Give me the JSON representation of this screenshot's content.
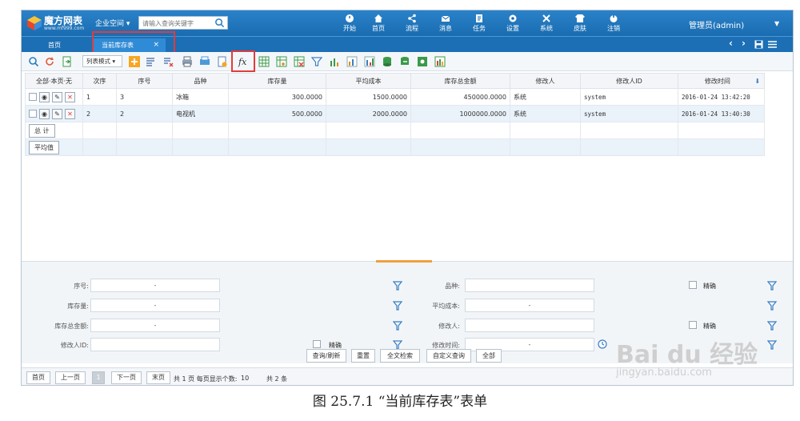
{
  "app": {
    "title": "魔方网表",
    "url": "www.mf999.com",
    "space_menu": "企业空间 ▾",
    "search_placeholder": "请输入查询关键字",
    "user": "管理员(admin)"
  },
  "nav": [
    {
      "label": "开始",
      "icon": "power-icon"
    },
    {
      "label": "首页",
      "icon": "home-icon"
    },
    {
      "label": "流程",
      "icon": "share-icon"
    },
    {
      "label": "消息",
      "icon": "mail-icon"
    },
    {
      "label": "任务",
      "icon": "clipboard-icon"
    },
    {
      "label": "设置",
      "icon": "gear-icon"
    },
    {
      "label": "系统",
      "icon": "tools-icon"
    },
    {
      "label": "皮肤",
      "icon": "shirt-icon"
    },
    {
      "label": "注销",
      "icon": "logout-icon"
    }
  ],
  "tabs": {
    "home": "首页",
    "active": "当前库存表",
    "close": "×"
  },
  "toolbar": {
    "mode": "列表模式 ▾"
  },
  "grid": {
    "selector_header": "全部·本页·无",
    "columns": [
      "次序",
      "序号",
      "品种",
      "库存量",
      "平均成本",
      "库存总金额",
      "修改人",
      "修改人ID",
      "修改时间"
    ],
    "rows": [
      [
        "1",
        "3",
        "冰箱",
        "300.0000",
        "1500.0000",
        "450000.0000",
        "系统",
        "system",
        "2016-01-24 13:42:20"
      ],
      [
        "2",
        "2",
        "电视机",
        "500.0000",
        "2000.0000",
        "1000000.0000",
        "系统",
        "system",
        "2016-01-24 13:40:30"
      ]
    ],
    "total_label": "总 计",
    "avg_label": "平均值"
  },
  "filter": {
    "labels": {
      "seq": "序号:",
      "kind": "品种:",
      "qty": "库存量:",
      "avg": "平均成本:",
      "total": "库存总金额:",
      "editor": "修改人:",
      "editor_id": "修改人ID:",
      "mtime": "修改时间:"
    },
    "range_dash": "-",
    "exact": "精确",
    "buttons": [
      "查询/刷新",
      "重置",
      "全文检索",
      "自定义查询",
      "全部"
    ]
  },
  "pager": {
    "first": "首页",
    "prev": "上一页",
    "current": "1",
    "next": "下一页",
    "last": "末页",
    "info": "共 1 页 每页显示个数:",
    "page_size": "10",
    "count": "共 2 条"
  },
  "caption": "图 25.7.1 “当前库存表”表单",
  "watermark": {
    "brand": "Bai du 经验",
    "site": "jingyan.baidu.com"
  }
}
